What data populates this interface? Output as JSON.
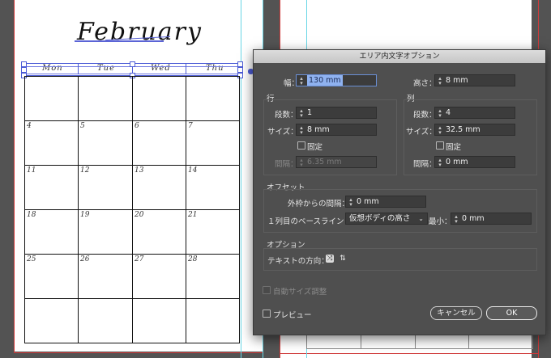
{
  "canvas": {
    "title": "February",
    "weekdays": [
      "Mon",
      "Tue",
      "Wed",
      "Thu"
    ],
    "day_numbers": [
      "4",
      "5",
      "6",
      "7",
      "11",
      "12",
      "13",
      "14",
      "18",
      "19",
      "20",
      "21",
      "25",
      "26",
      "27",
      "28"
    ]
  },
  "dialog": {
    "title": "エリア内文字オプション",
    "width_label": "幅：",
    "width_value": "130 mm",
    "height_label": "高さ：",
    "height_value": "8 mm",
    "rows": {
      "heading": "行",
      "count_label": "段数：",
      "count_value": "1",
      "size_label": "サイズ：",
      "size_value": "8 mm",
      "fixed_label": "固定",
      "gutter_label": "間隔：",
      "gutter_value": "6.35 mm"
    },
    "columns": {
      "heading": "列",
      "count_label": "段数：",
      "count_value": "4",
      "size_label": "サイズ：",
      "size_value": "32.5 mm",
      "fixed_label": "固定",
      "gutter_label": "間隔：",
      "gutter_value": "0 mm"
    },
    "offset": {
      "heading": "オフセット",
      "inset_label": "外枠からの間隔：",
      "inset_value": "0 mm",
      "baseline_label": "１列目のベースライン：",
      "baseline_value": "仮想ボディの高さ",
      "min_label": "最小：",
      "min_value": "0 mm"
    },
    "options": {
      "heading": "オプション",
      "direction_label": "テキストの方向："
    },
    "auto_size_label": "自動サイズ調整",
    "preview_label": "プレビュー",
    "cancel_label": "キャンセル",
    "ok_label": "OK"
  },
  "colors": {
    "selection_blue": "#4b5bd6",
    "guide_red": "#d03a3a",
    "guide_cyan": "#69d6e6"
  }
}
